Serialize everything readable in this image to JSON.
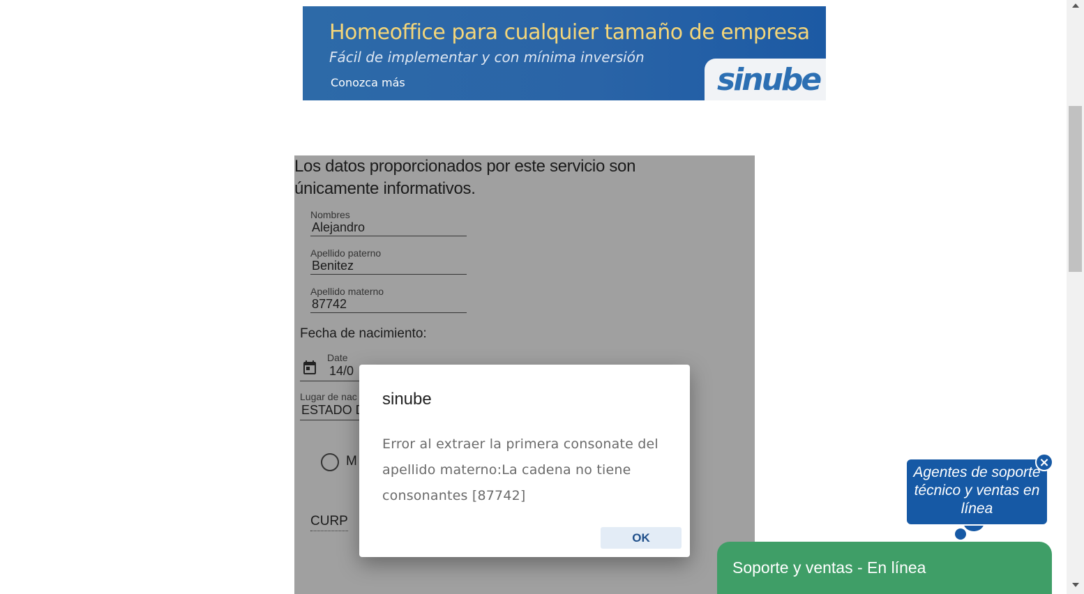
{
  "banner": {
    "title": "Homeoffice para cualquier tamaño de empresa",
    "subtitle": "Fácil de implementar y con mínima inversión",
    "link": "Conozca más",
    "logo": "sinube"
  },
  "form": {
    "notice": "Los datos proporcionados por este servicio son únicamente informativos.",
    "fields": [
      {
        "label": "Nombres",
        "value": "Alejandro"
      },
      {
        "label": "Apellido paterno",
        "value": "Benitez"
      },
      {
        "label": "Apellido materno",
        "value": "87742"
      }
    ],
    "birth_section_label": "Fecha de nacimiento:",
    "date": {
      "label": "Date",
      "value": "14/0",
      "icon": "calendar-icon"
    },
    "birthplace": {
      "label": "Lugar de nac",
      "value": "ESTADO D"
    },
    "sex_radio_label": "M",
    "curp_label": "CURP"
  },
  "dialog": {
    "title": "sinube",
    "message": "Error al extraer la primera consonate del apellido materno:La cadena no tiene consonantes [87742]",
    "ok_label": "OK"
  },
  "chat": {
    "bubble_text": "Agentes de soporte técnico y ventas en línea",
    "close_label": "×",
    "bar_label": "Soporte y ventas - En línea",
    "bar_color": "#3f9e67",
    "bubble_color": "#1659a5"
  }
}
